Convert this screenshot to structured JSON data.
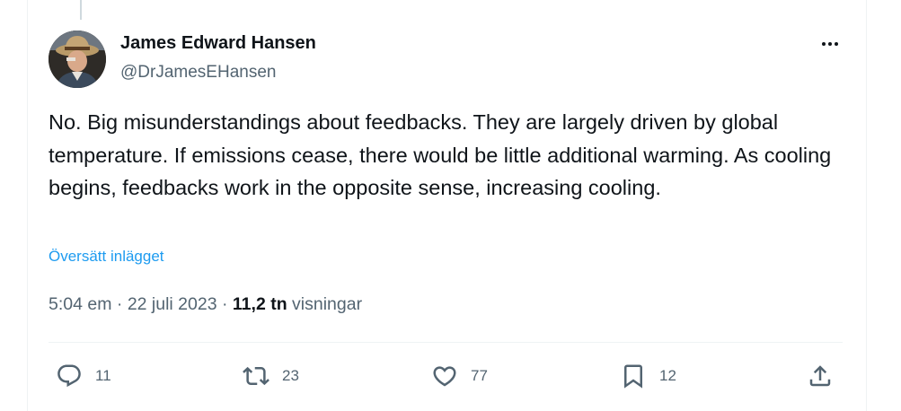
{
  "author": {
    "name": "James Edward Hansen",
    "handle": "@DrJamesEHansen"
  },
  "tweet": {
    "text": "No. Big misunderstandings about feedbacks. They are largely driven by global temperature. If emissions cease, there would be little additional warming. As cooling begins, feedbacks work in the opposite sense, increasing cooling.",
    "translate_label": "Översätt inlägget",
    "time": "5:04 em",
    "separator": " · ",
    "date": "22 juli 2023",
    "views_count": "11,2 tn",
    "views_label": "visningar"
  },
  "actions": {
    "reply": {
      "icon": "reply-icon",
      "count": "11"
    },
    "retweet": {
      "icon": "retweet-icon",
      "count": "23"
    },
    "like": {
      "icon": "heart-icon",
      "count": "77"
    },
    "bookmark": {
      "icon": "bookmark-icon",
      "count": "12"
    },
    "share": {
      "icon": "share-icon"
    }
  },
  "colors": {
    "text": "#0f1419",
    "muted": "#536471",
    "link": "#1d9bf0",
    "border": "#eff3f4"
  }
}
